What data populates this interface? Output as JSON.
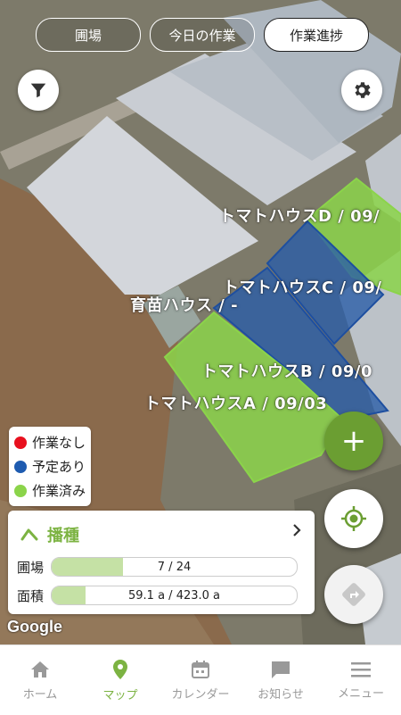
{
  "tabs": [
    {
      "label": "圃場",
      "active": false
    },
    {
      "label": "今日の作業",
      "active": false
    },
    {
      "label": "作業進捗",
      "active": true
    }
  ],
  "buttons": {
    "filter_icon": "filter-icon",
    "settings_icon": "gear-icon"
  },
  "map": {
    "field_labels": [
      {
        "name": "トマトハウスD",
        "date": "09/"
      },
      {
        "name": "トマトハウスC",
        "date": "09/"
      },
      {
        "name": "育苗ハウス",
        "date": "-"
      },
      {
        "name": "トマトハウスB",
        "date": "09/0"
      },
      {
        "name": "トマトハウスA",
        "date": "09/03"
      }
    ],
    "separator": "/",
    "attribution": "Google"
  },
  "legend": [
    {
      "label": "作業なし",
      "color": "#e8101e"
    },
    {
      "label": "予定あり",
      "color": "#1e5bb0"
    },
    {
      "label": "作業済み",
      "color": "#8bd44a"
    }
  ],
  "summary": {
    "title": "播種",
    "rows": [
      {
        "label": "圃場",
        "value_text": "7 / 24",
        "progress": 0.2917
      },
      {
        "label": "面積",
        "value_text": "59.1 a / 423.0 a",
        "progress": 0.1397
      }
    ]
  },
  "fabs": {
    "add": "+",
    "accent": "#6b9e32"
  },
  "nav": [
    {
      "label": "ホーム",
      "icon": "home-icon",
      "active": false
    },
    {
      "label": "マップ",
      "icon": "map-pin-icon",
      "active": true
    },
    {
      "label": "カレンダー",
      "icon": "calendar-icon",
      "active": false
    },
    {
      "label": "お知らせ",
      "icon": "message-icon",
      "active": false
    },
    {
      "label": "メニュー",
      "icon": "menu-icon",
      "active": false
    }
  ]
}
